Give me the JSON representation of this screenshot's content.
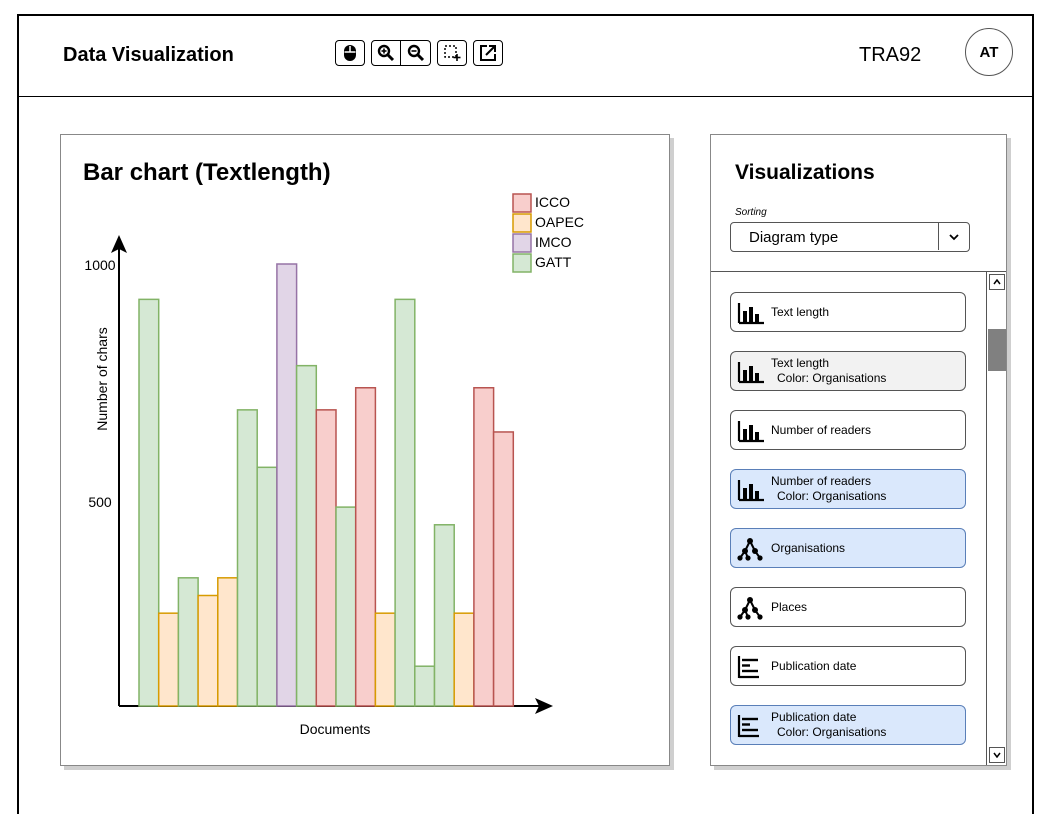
{
  "app": {
    "title": "Data Visualization",
    "user_code": "TRA92",
    "avatar_initials": "AT"
  },
  "toolbar": {
    "buttons": [
      {
        "name": "mouse-icon"
      },
      {
        "name": "zoom-in-icon"
      },
      {
        "name": "zoom-out-icon"
      },
      {
        "name": "add-selection-icon"
      },
      {
        "name": "export-icon"
      }
    ]
  },
  "chart": {
    "title": "Bar chart (Textlength)",
    "xlabel": "Documents",
    "ylabel": "Number of chars",
    "ytick_1000": "1000",
    "ytick_500": "500"
  },
  "chart_data": {
    "type": "bar",
    "title": "Bar chart (Textlength)",
    "xlabel": "Documents",
    "ylabel": "Number of chars",
    "yticks": [
      500,
      1000
    ],
    "legend_position": "top-right",
    "series_colors": {
      "ICCO": {
        "fill": "#f8cecc",
        "stroke": "#b85450"
      },
      "OAPEC": {
        "fill": "#ffe6cc",
        "stroke": "#d79b00"
      },
      "IMCO": {
        "fill": "#e1d5e7",
        "stroke": "#9673a6"
      },
      "GATT": {
        "fill": "#d5e8d4",
        "stroke": "#82b366"
      }
    },
    "legend": [
      "ICCO",
      "OAPEC",
      "IMCO",
      "GATT"
    ],
    "bars": [
      {
        "org": "GATT",
        "value": 920
      },
      {
        "org": "OAPEC",
        "value": 210
      },
      {
        "org": "GATT",
        "value": 290
      },
      {
        "org": "OAPEC",
        "value": 250
      },
      {
        "org": "OAPEC",
        "value": 290
      },
      {
        "org": "GATT",
        "value": 670
      },
      {
        "org": "GATT",
        "value": 540
      },
      {
        "org": "IMCO",
        "value": 1000
      },
      {
        "org": "GATT",
        "value": 770
      },
      {
        "org": "ICCO",
        "value": 670
      },
      {
        "org": "GATT",
        "value": 450
      },
      {
        "org": "ICCO",
        "value": 720
      },
      {
        "org": "OAPEC",
        "value": 210
      },
      {
        "org": "GATT",
        "value": 920
      },
      {
        "org": "GATT",
        "value": 90
      },
      {
        "org": "GATT",
        "value": 410
      },
      {
        "org": "OAPEC",
        "value": 210
      },
      {
        "org": "ICCO",
        "value": 720
      },
      {
        "org": "ICCO",
        "value": 620
      }
    ]
  },
  "visualizations": {
    "title": "Visualizations",
    "sorting_label": "Sorting",
    "sorting_value": "Diagram type",
    "items": [
      {
        "label": "Text length",
        "sub": "",
        "icon": "bar-chart-icon",
        "style": "plain"
      },
      {
        "label": "Text length",
        "sub": "Color: Organisations",
        "icon": "bar-chart-icon",
        "style": "light"
      },
      {
        "label": "Number of readers",
        "sub": "",
        "icon": "bar-chart-icon",
        "style": "plain"
      },
      {
        "label": "Number of readers",
        "sub": "Color: Organisations",
        "icon": "bar-chart-icon",
        "style": "blue"
      },
      {
        "label": "Organisations",
        "sub": "",
        "icon": "network-icon",
        "style": "blue"
      },
      {
        "label": "Places",
        "sub": "",
        "icon": "network-icon",
        "style": "plain"
      },
      {
        "label": "Publication date",
        "sub": "",
        "icon": "timeline-icon",
        "style": "plain"
      },
      {
        "label": "Publication date",
        "sub": "Color: Organisations",
        "icon": "timeline-icon",
        "style": "blue"
      }
    ]
  }
}
